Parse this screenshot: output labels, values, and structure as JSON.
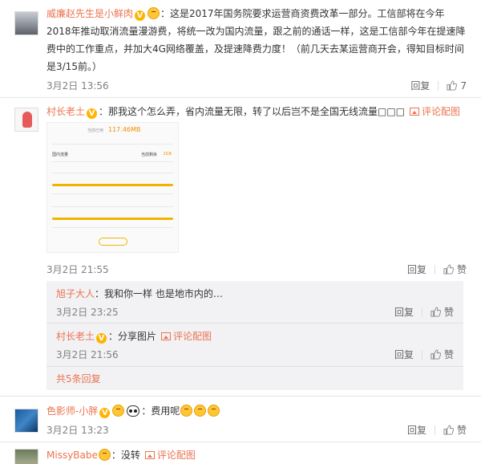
{
  "comments": [
    {
      "username": "威廉赵先生是小鲜肉",
      "text": "：这是2017年国务院要求运营商资费改革一部分。工信部将在今年2018年推动取消流量漫游费，将统一改为国内流量，跟之前的通话一样，这是工信部今年在提速降费中的工作重点，并加大4G网络覆盖，及提速降费力度！（前几天去某运营商开会，得知目标时间是3/15前。）",
      "time": "3月2日 13:56",
      "reply": "回复",
      "likes": "7"
    },
    {
      "username": "村长老土",
      "text": "：那我这个怎么弄，省内流量无限，转了以后岂不是全国无线流量",
      "trailing_glyphs": "□□□",
      "pic_label": "评论配图",
      "time": "3月2日 21:55",
      "reply": "回复",
      "like": "赞",
      "screenshot": {
        "top_label": "当前已用",
        "top_value": "117.46MB",
        "section_title": "国内流量",
        "section_right_label": "当前剩余",
        "section_right_value": "2GB"
      },
      "sub_replies": [
        {
          "username": "旭子大人",
          "text": "：我和你一样 也是地市内的…",
          "time": "3月2日 23:25",
          "reply": "回复",
          "like": "赞"
        },
        {
          "username": "村长老土",
          "text": "：分享图片",
          "pic_label": "评论配图",
          "time": "3月2日 21:56",
          "reply": "回复",
          "like": "赞"
        }
      ],
      "more_replies": "共5条回复"
    },
    {
      "username": "色影师-小胖",
      "text": "：费用呢",
      "time": "3月2日 13:23",
      "reply": "回复",
      "like": "赞"
    },
    {
      "username": "MissyBabe",
      "text": "：没转",
      "pic_label": "评论配图"
    }
  ],
  "colors": {
    "username": "#eb7350",
    "meta": "#808080",
    "sub_bg": "#f2f2f5"
  }
}
